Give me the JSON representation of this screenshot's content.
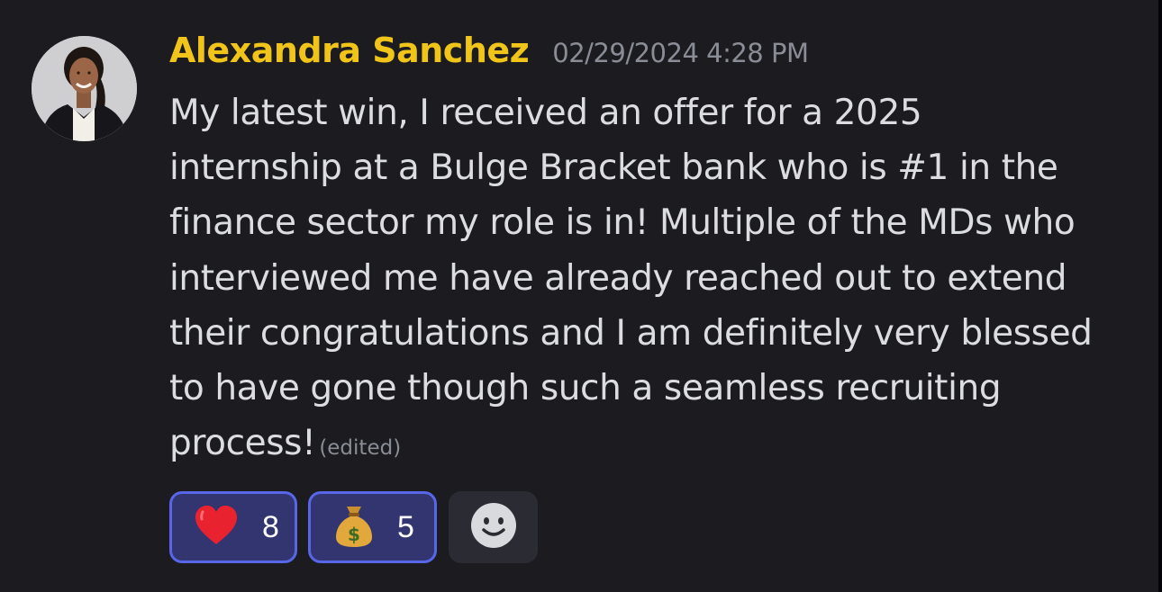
{
  "message": {
    "author": "Alexandra Sanchez",
    "timestamp": "02/29/2024 4:28 PM",
    "lines": [
      "My latest win, I received an offer for a 2025",
      "internship at a Bulge Bracket bank who is #1 in the",
      "finance sector my role is in! Multiple of the MDs who",
      "interviewed me have already reached out to extend",
      "their congratulations and I am definitely very blessed",
      "to have gone though such a seamless recruiting",
      "process!"
    ],
    "edited_label": "(edited)"
  },
  "reactions": [
    {
      "emoji": "❤️",
      "icon": "red-heart-icon",
      "count": "8"
    },
    {
      "emoji": "💰",
      "icon": "money-bag-icon",
      "count": "5"
    }
  ],
  "add_reaction": {
    "icon": "smiley-face-icon"
  },
  "colors": {
    "background": "#1b1b20",
    "author": "#f0c419",
    "timestamp": "#8a8d96",
    "message_text": "#dcdde1",
    "reaction_active_bg": "#323570",
    "reaction_active_border": "#5866e8",
    "add_reaction_bg": "#2b2c33"
  }
}
